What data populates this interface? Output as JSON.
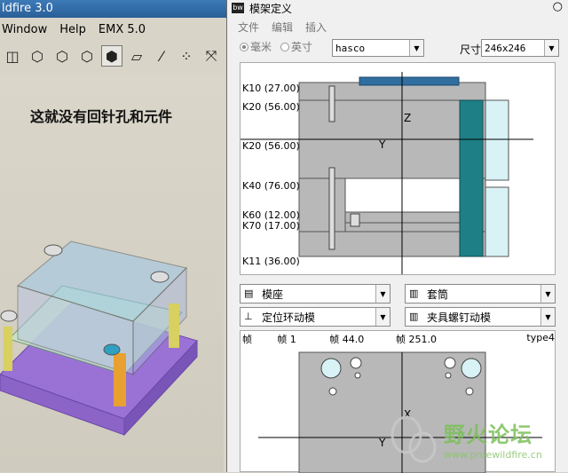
{
  "bg_app": {
    "title": "ldfire 3.0",
    "menu": [
      "Window",
      "Help",
      "EMX 5.0"
    ],
    "model_label": "这就没有回针孔和元件"
  },
  "dialog": {
    "title": "模架定义",
    "menu": [
      "文件",
      "编辑",
      "插入"
    ],
    "units": {
      "mm": "毫米",
      "inch": "英寸",
      "selected": "mm"
    },
    "catalog": "hasco",
    "size_label": "尺寸",
    "size": "246x246",
    "plate_labels": [
      "K10 (27.00)",
      "K20 (56.00)",
      "K20 (56.00)",
      "K40 (76.00)",
      "K60 (12.00)",
      "K70 (17.00)",
      "K11 (36.00)"
    ],
    "view_labels": {
      "z": "Z",
      "y": "Y"
    },
    "dropdowns": [
      {
        "icon": "base-icon",
        "label": "模座"
      },
      {
        "icon": "sleeve-icon",
        "label": "套筒"
      },
      {
        "icon": "locating-ring-icon",
        "label": "定位环动模"
      },
      {
        "icon": "clamp-screw-icon",
        "label": "夹具螺钉动模"
      }
    ],
    "bottom_info": {
      "a": "帧",
      "b": "帧 1",
      "c": "帧 44.0",
      "d": "帧 251.0",
      "e": "type4"
    },
    "bottom_axis": {
      "x": "X",
      "y": "Y"
    }
  },
  "watermark": {
    "text": "野火论坛",
    "url": "www.proewildfire.cn"
  },
  "colors": {
    "plate_gray": "#b8b8b8",
    "teal": "#1e7f86",
    "dark_blue": "#2f6e9e",
    "light_cyan": "#d8f2f6"
  }
}
